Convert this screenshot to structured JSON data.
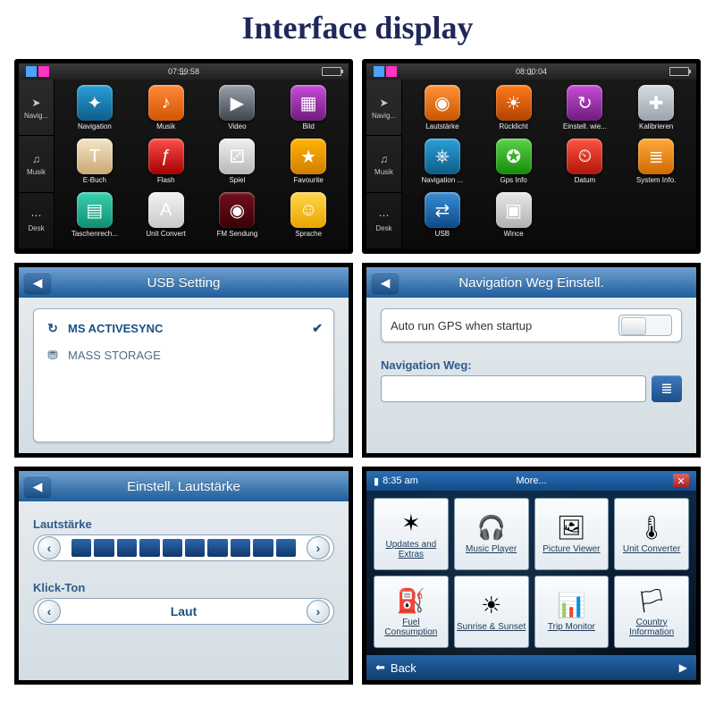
{
  "page_title": "Interface display",
  "colors": {
    "accent_blue": "#1f5e9b",
    "dark_bg": "#111111"
  },
  "home1": {
    "time": "07:59:58",
    "side": [
      {
        "label": "Navig...",
        "icon": "➤"
      },
      {
        "label": "Musik",
        "icon": "♫"
      },
      {
        "label": "Desk",
        "icon": "⋯"
      }
    ],
    "apps": [
      {
        "label": "Navigation",
        "icon": "✦",
        "bg": "linear-gradient(#2aa0d8,#0c5d8a)"
      },
      {
        "label": "Musik",
        "icon": "♪",
        "bg": "linear-gradient(#ff8a3a,#d25400)"
      },
      {
        "label": "Video",
        "icon": "▶",
        "bg": "linear-gradient(#9aa2ad,#3d444c)"
      },
      {
        "label": "Bild",
        "icon": "▦",
        "bg": "linear-gradient(#c84dd8,#6e1c7c)"
      },
      {
        "label": "E-Buch",
        "icon": "T",
        "bg": "linear-gradient(#f4e6c8,#caa874)"
      },
      {
        "label": "Flash",
        "icon": "ƒ",
        "bg": "linear-gradient(#ff4d4d,#a60000)"
      },
      {
        "label": "Spiel",
        "icon": "⚂",
        "bg": "linear-gradient(#f0f0f0,#b8b8b8)"
      },
      {
        "label": "Favourite",
        "icon": "★",
        "bg": "linear-gradient(#ffb300,#d07f00)"
      },
      {
        "label": "Taschenrech...",
        "icon": "▤",
        "bg": "linear-gradient(#3bd1b0,#0d8f72)"
      },
      {
        "label": "Unit Convert",
        "icon": "A",
        "bg": "linear-gradient(#f3f3f3,#c8c8c8)"
      },
      {
        "label": "FM Sendung",
        "icon": "◉",
        "bg": "linear-gradient(#720f1b,#3a0006)"
      },
      {
        "label": "Sprache",
        "icon": "☺",
        "bg": "linear-gradient(#ffd84d,#e8a400)"
      }
    ]
  },
  "home2": {
    "time": "08:00:04",
    "side": [
      {
        "label": "Navig...",
        "icon": "➤"
      },
      {
        "label": "Musik",
        "icon": "♫"
      },
      {
        "label": "Desk",
        "icon": "⋯"
      }
    ],
    "apps": [
      {
        "label": "Lautstärke",
        "icon": "◉",
        "bg": "linear-gradient(#ff943a,#c95500)"
      },
      {
        "label": "Rücklicht",
        "icon": "☀",
        "bg": "linear-gradient(#ff7a1a,#b24300)"
      },
      {
        "label": "Einstell. wie...",
        "icon": "↻",
        "bg": "linear-gradient(#c84dd8,#6e1c7c)"
      },
      {
        "label": "Kalibrieren",
        "icon": "✚",
        "bg": "linear-gradient(#d7dde2,#9aa4ad)"
      },
      {
        "label": "Navigation ...",
        "icon": "⎈",
        "bg": "linear-gradient(#2aa0d8,#0c5d8a)"
      },
      {
        "label": "Gps Info",
        "icon": "✪",
        "bg": "linear-gradient(#5bd24a,#168c08)"
      },
      {
        "label": "Datum",
        "icon": "⏲",
        "bg": "linear-gradient(#ff5343,#af1608)"
      },
      {
        "label": "System Info.",
        "icon": "≣",
        "bg": "linear-gradient(#ffa93a,#d06a00)"
      },
      {
        "label": "USB",
        "icon": "⇄",
        "bg": "linear-gradient(#3a8ed8,#0d4a86)"
      },
      {
        "label": "Wince",
        "icon": "▣",
        "bg": "linear-gradient(#e8e8e8,#b0b0b0)"
      }
    ]
  },
  "usb": {
    "title": "USB Setting",
    "options": [
      {
        "label": "MS ACTIVESYNC",
        "selected": true,
        "icon": "↻"
      },
      {
        "label": "MASS STORAGE",
        "selected": false,
        "icon": "⛃"
      }
    ]
  },
  "navpath": {
    "title": "Navigation Weg Einstell.",
    "autorun_label": "Auto run GPS when startup",
    "path_label": "Navigation Weg:",
    "path_value": "",
    "browse_icon": "≣"
  },
  "volume": {
    "title": "Einstell. Lautstärke",
    "vol_label": "Lautstärke",
    "vol_level": 10,
    "vol_max": 10,
    "click_label": "Klick-Ton",
    "click_value": "Laut"
  },
  "more": {
    "time": "8:35 am",
    "title": "More...",
    "back": "Back",
    "close": "✕",
    "tiles": [
      {
        "label": "Updates and Extras",
        "icon": "✶"
      },
      {
        "label": "Music Player",
        "icon": "🎧"
      },
      {
        "label": "Picture Viewer",
        "icon": "🖼"
      },
      {
        "label": "Unit Converter",
        "icon": "🌡"
      },
      {
        "label": "Fuel Consumption",
        "icon": "⛽"
      },
      {
        "label": "Sunrise & Sunset",
        "icon": "☀"
      },
      {
        "label": "Trip Monitor",
        "icon": "📊"
      },
      {
        "label": "Country Information",
        "icon": "🏳"
      }
    ]
  }
}
